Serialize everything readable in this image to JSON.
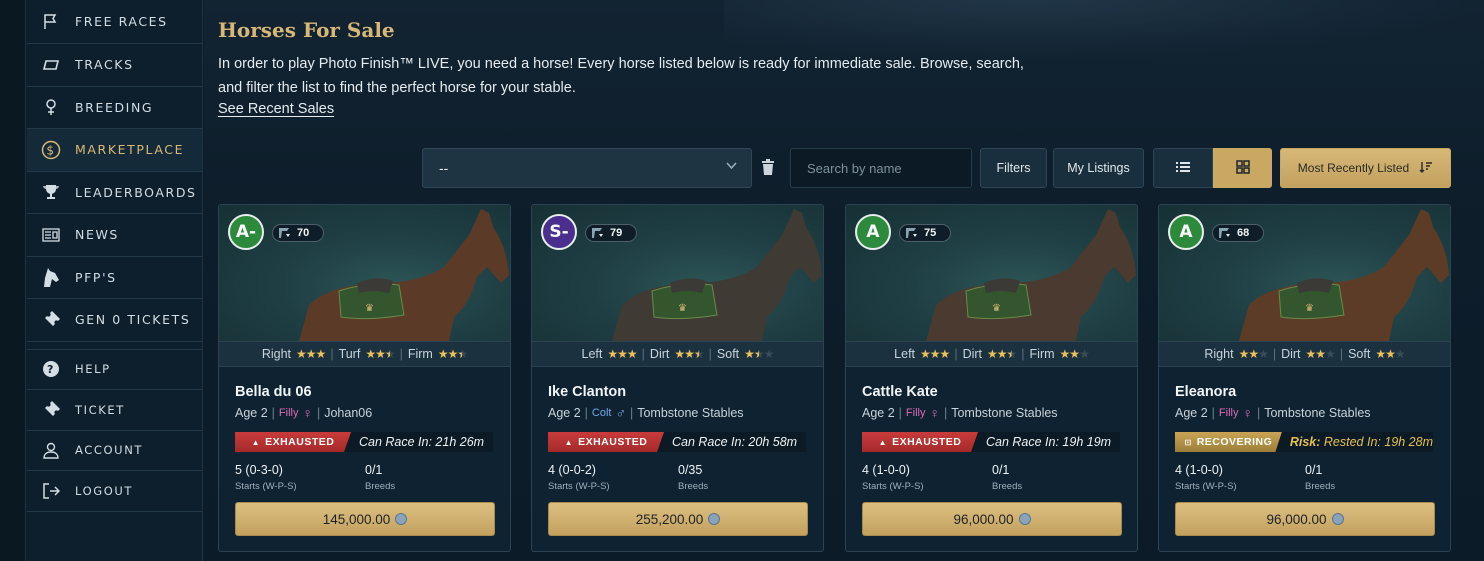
{
  "sidebar": {
    "items": [
      {
        "label": "FREE RACES",
        "icon": "flag-icon"
      },
      {
        "label": "TRACKS",
        "icon": "track-icon"
      },
      {
        "label": "BREEDING",
        "icon": "breeding-icon"
      },
      {
        "label": "MARKETPLACE",
        "icon": "dollar-coin-icon",
        "active": true
      },
      {
        "label": "LEADERBOARDS",
        "icon": "trophy-icon"
      },
      {
        "label": "NEWS",
        "icon": "newspaper-icon"
      },
      {
        "label": "PFP'S",
        "icon": "horse-head-icon"
      },
      {
        "label": "GEN 0 TICKETS",
        "icon": "ticket-icon"
      }
    ],
    "secondary": [
      {
        "label": "HELP",
        "icon": "help-icon"
      },
      {
        "label": "TICKET",
        "icon": "ticket-icon"
      },
      {
        "label": "ACCOUNT",
        "icon": "user-icon"
      },
      {
        "label": "LOGOUT",
        "icon": "logout-icon"
      }
    ]
  },
  "page": {
    "title": "Horses For Sale",
    "intro": "In order to play Photo Finish™ LIVE, you need a horse! Every horse listed below is ready for immediate sale. Browse, search, and filter the list to find the perfect horse for your stable.",
    "recent_link": "See Recent Sales"
  },
  "toolbar": {
    "select_value": "--",
    "search_placeholder": "Search by name",
    "filters_label": "Filters",
    "my_listings_label": "My Listings",
    "sort_label": "Most Recently Listed"
  },
  "cards": [
    {
      "grade": "A-",
      "grade_color": "#2d8a3c",
      "rating": "70",
      "prefs": [
        {
          "label": "Right",
          "stars": 3
        },
        {
          "label": "Turf",
          "stars": 2.5
        },
        {
          "label": "Firm",
          "stars": 2.5
        }
      ],
      "name": "Bella du 06",
      "age": "Age 2",
      "sex": "Filly",
      "sex_type": "f",
      "owner": "Johan06",
      "status": "EXHAUSTED",
      "status_type": "red",
      "status_prefix": "",
      "status_text": "Can Race In: 21h 26m",
      "record": "5 (0-3-0)",
      "record_label": "Starts (W-P-S)",
      "breeds": "0/1",
      "breeds_label": "Breeds",
      "price": "145,000.00"
    },
    {
      "grade": "S-",
      "grade_color": "#4a2f8f",
      "rating": "79",
      "prefs": [
        {
          "label": "Left",
          "stars": 3
        },
        {
          "label": "Dirt",
          "stars": 2.5
        },
        {
          "label": "Soft",
          "stars": 1.5
        }
      ],
      "name": "Ike Clanton",
      "age": "Age 2",
      "sex": "Colt",
      "sex_type": "m",
      "owner": "Tombstone Stables",
      "status": "EXHAUSTED",
      "status_type": "red",
      "status_prefix": "",
      "status_text": "Can Race In: 20h 58m",
      "record": "4 (0-0-2)",
      "record_label": "Starts (W-P-S)",
      "breeds": "0/35",
      "breeds_label": "Breeds",
      "price": "255,200.00"
    },
    {
      "grade": "A",
      "grade_color": "#2d8a3c",
      "rating": "75",
      "prefs": [
        {
          "label": "Left",
          "stars": 3
        },
        {
          "label": "Dirt",
          "stars": 2.5
        },
        {
          "label": "Firm",
          "stars": 2
        }
      ],
      "name": "Cattle Kate",
      "age": "Age 2",
      "sex": "Filly",
      "sex_type": "f",
      "owner": "Tombstone Stables",
      "status": "EXHAUSTED",
      "status_type": "red",
      "status_prefix": "",
      "status_text": "Can Race In: 19h 19m",
      "record": "4 (1-0-0)",
      "record_label": "Starts (W-P-S)",
      "breeds": "0/1",
      "breeds_label": "Breeds",
      "price": "96,000.00"
    },
    {
      "grade": "A",
      "grade_color": "#2d8a3c",
      "rating": "68",
      "prefs": [
        {
          "label": "Right",
          "stars": 2
        },
        {
          "label": "Dirt",
          "stars": 2
        },
        {
          "label": "Soft",
          "stars": 2
        }
      ],
      "name": "Eleanora",
      "age": "Age 2",
      "sex": "Filly",
      "sex_type": "f",
      "owner": "Tombstone Stables",
      "status": "RECOVERING",
      "status_type": "gold",
      "status_prefix": "Risk:",
      "status_text": "Rested In: 19h 28m",
      "record": "4 (1-0-0)",
      "record_label": "Starts (W-P-S)",
      "breeds": "0/1",
      "breeds_label": "Breeds",
      "price": "96,000.00"
    }
  ]
}
